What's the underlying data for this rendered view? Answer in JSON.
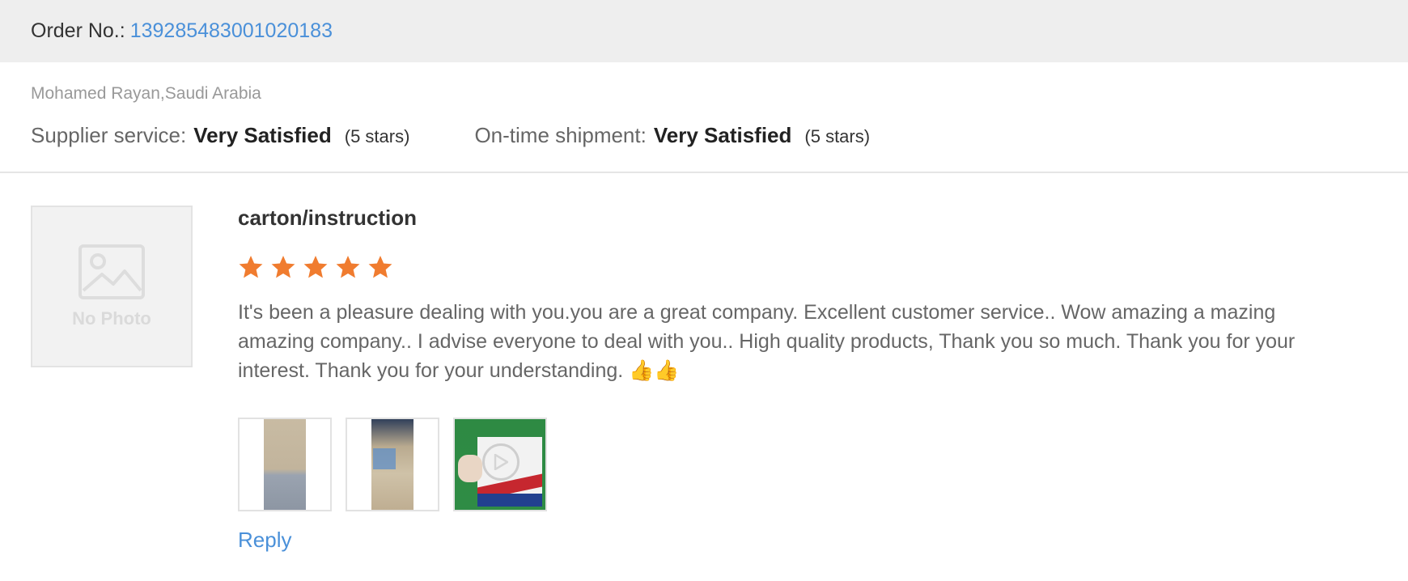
{
  "order": {
    "label": "Order No.:",
    "number": "139285483001020183"
  },
  "buyer": {
    "name_country": "Mohamed Rayan,Saudi Arabia"
  },
  "ratings": [
    {
      "label": "Supplier service:",
      "value": "Very Satisfied",
      "stars": "(5 stars)"
    },
    {
      "label": "On-time shipment:",
      "value": "Very Satisfied",
      "stars": "(5 stars)"
    }
  ],
  "product": {
    "photo_placeholder": "No Photo"
  },
  "review": {
    "title": "carton/instruction",
    "rating": 5,
    "rating_max": 5,
    "star_color": "#f07c2f",
    "text": "It's been a pleasure dealing with you.you are a great company. Excellent customer service.. Wow amazing a mazing amazing company.. I advise everyone to deal with you.. High quality products, Thank you so much. Thank you for your interest. Thank you for your understanding. 👍👍",
    "attachments": [
      {
        "kind": "image",
        "icon": "photo-thumbnail"
      },
      {
        "kind": "image",
        "icon": "photo-thumbnail"
      },
      {
        "kind": "video",
        "icon": "play-icon"
      }
    ],
    "reply_label": "Reply"
  },
  "colors": {
    "link": "#4a90d9",
    "header_bg": "#eeeeee",
    "star": "#f07c2f"
  }
}
